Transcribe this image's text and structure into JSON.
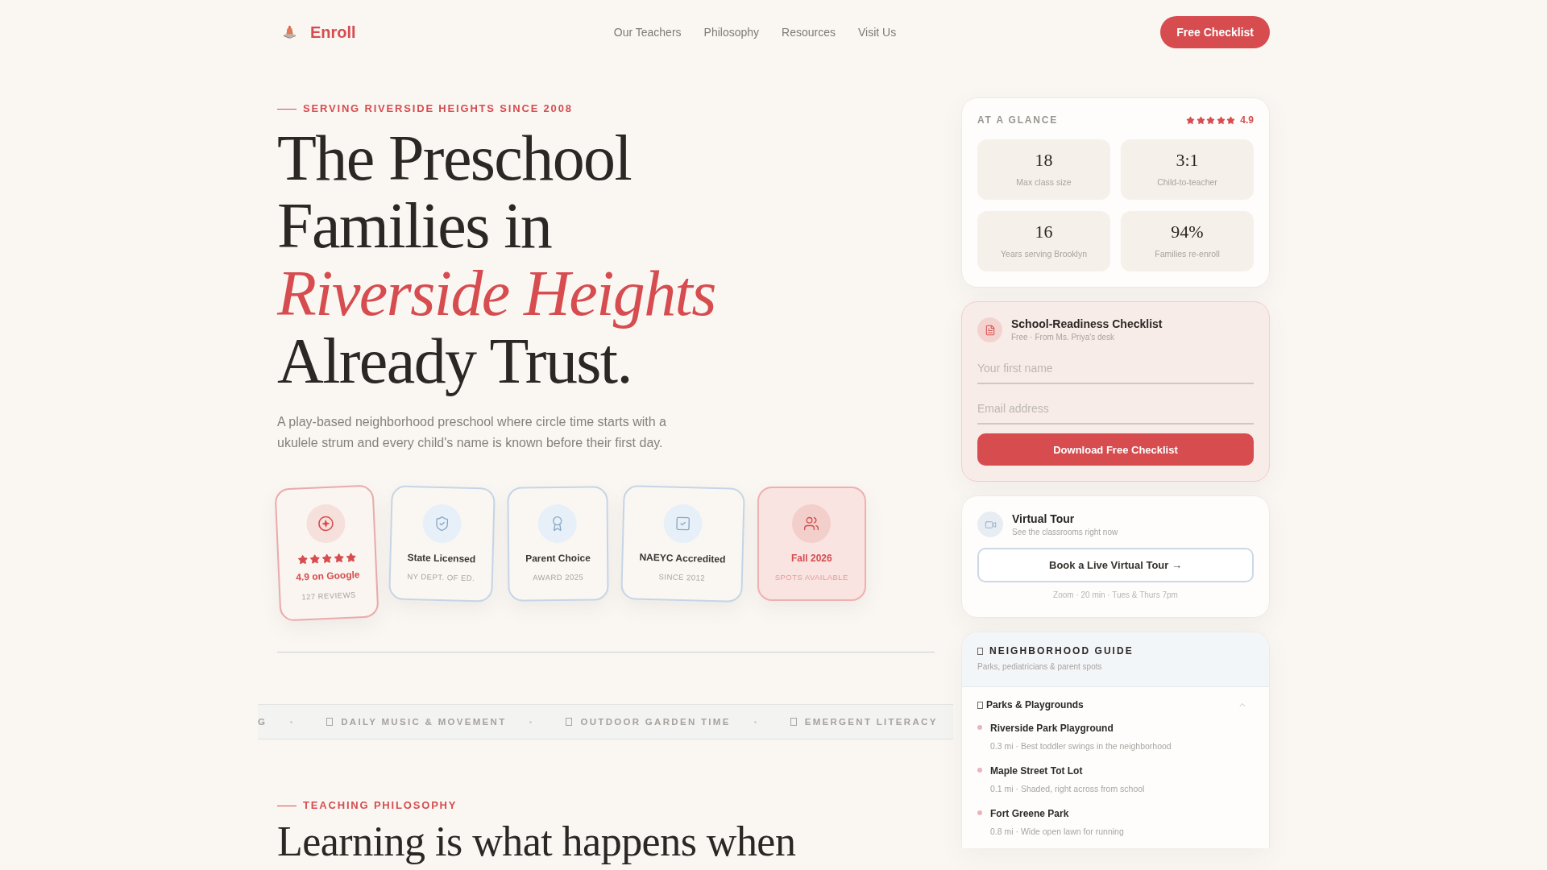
{
  "header": {
    "brand": "Enroll",
    "nav": [
      "Our Teachers",
      "Philosophy",
      "Resources",
      "Visit Us"
    ],
    "cta": "Free Checklist"
  },
  "hero": {
    "eyebrow": "SERVING RIVERSIDE HEIGHTS SINCE 2008",
    "headline": "The Preschool Families in *Riverside Heights* Already Trust.",
    "intro": "A play-based neighborhood preschool where circle time starts with a ukulele strum and every child's name is known before their first day.",
    "badges": [
      {
        "kind": "rating",
        "stars": 5,
        "title": "4.9 on Google",
        "subtitle": "127 REVIEWS"
      },
      {
        "kind": "license",
        "title": "State Licensed",
        "subtitle": "NY DEPT. OF ED."
      },
      {
        "kind": "award",
        "title": "Parent Choice",
        "subtitle": "AWARD 2025"
      },
      {
        "kind": "accreditation",
        "title": "NAEYC Accredited",
        "subtitle": "SINCE 2012"
      },
      {
        "kind": "availability",
        "title": "Fall 2026",
        "subtitle": "SPOTS AVAILABLE"
      }
    ]
  },
  "ticker": [
    {
      "kind": "fragment",
      "text": "G"
    },
    {
      "kind": "item",
      "text": "DAILY MUSIC & MOVEMENT"
    },
    {
      "kind": "item",
      "text": "OUTDOOR GARDEN TIME"
    },
    {
      "kind": "item",
      "text": "EMERGENT LITERACY"
    }
  ],
  "philosophy": {
    "eyebrow": "TEACHING PHILOSOPHY",
    "heading": "Learning is what happens when"
  },
  "sidebar": {
    "glance": {
      "title": "AT A GLANCE",
      "stars": 5,
      "rating": "4.9",
      "stats": [
        {
          "value": "18",
          "label": "Max class size"
        },
        {
          "value": "3:1",
          "label": "Child-to-teacher"
        },
        {
          "value": "16",
          "label": "Years serving Brooklyn"
        },
        {
          "value": "94%",
          "label": "Families re-enroll"
        }
      ]
    },
    "checklist": {
      "title": "School-Readiness Checklist",
      "subtitle": "Free · From Ms. Priya's desk",
      "fields": [
        {
          "placeholder": "Your first name"
        },
        {
          "placeholder": "Email address"
        }
      ],
      "button": "Download Free Checklist"
    },
    "tour": {
      "title": "Virtual Tour",
      "subtitle": "See the classrooms right now",
      "button": "Book a Live Virtual Tour →",
      "note": "Zoom · 20 min · Tues & Thurs 7pm"
    },
    "guide": {
      "title": "NEIGHBORHOOD GUIDE",
      "subtitle": "Parks, pediatricians & parent spots",
      "sections": [
        {
          "title": "Parks & Playgrounds",
          "expanded": true,
          "places": [
            {
              "name": "Riverside Park Playground",
              "detail": "0.3 mi · Best toddler swings in the neighborhood"
            },
            {
              "name": "Maple Street Tot Lot",
              "detail": "0.1 mi · Shaded, right across from school"
            },
            {
              "name": "Fort Greene Park",
              "detail": "0.8 mi · Wide open lawn for running"
            }
          ]
        }
      ]
    }
  }
}
